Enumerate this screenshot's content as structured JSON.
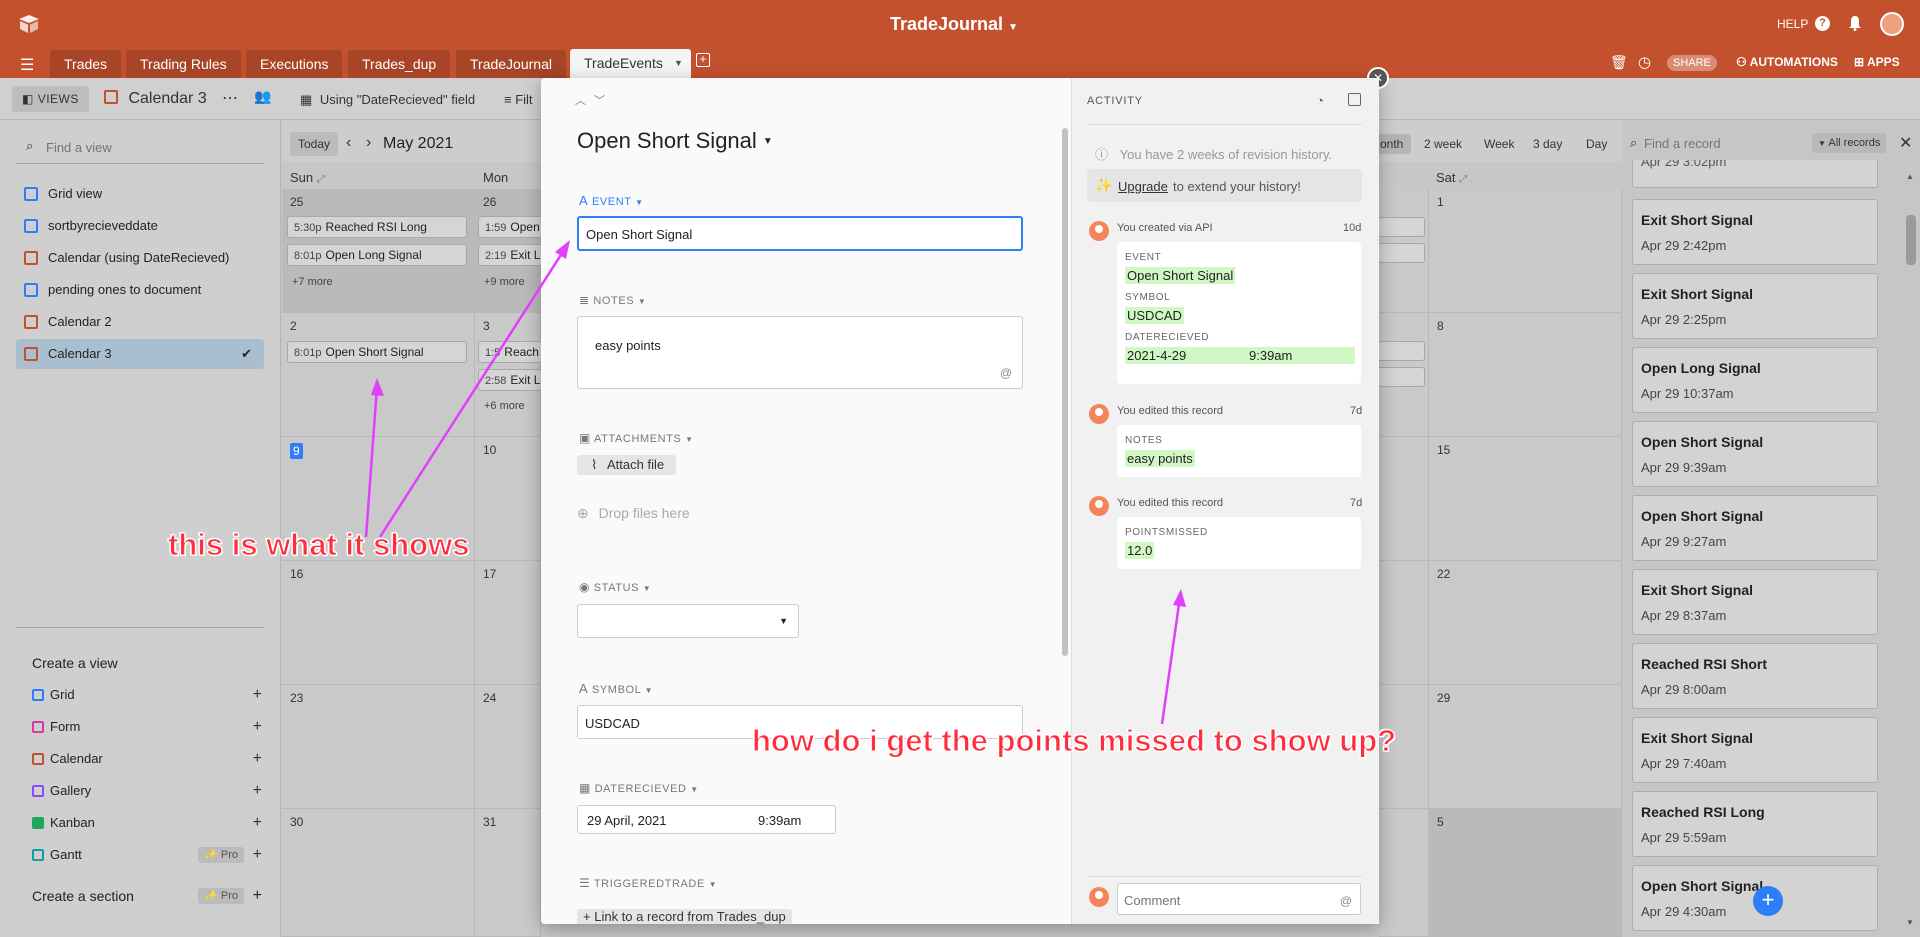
{
  "app": {
    "title": "TradeJournal",
    "help": "HELP"
  },
  "tabs": [
    "Trades",
    "Trading Rules",
    "Executions",
    "Trades_dup",
    "TradeJournal",
    "TradeEvents"
  ],
  "toolbar": {
    "views": "VIEWS",
    "view_name": "Calendar 3",
    "using": "Using \"DateRecieved\" field",
    "filter": "Filt",
    "share": "SHARE",
    "automations": "AUTOMATIONS",
    "apps": "APPS"
  },
  "sidebar": {
    "find_placeholder": "Find a view",
    "views": [
      "Grid view",
      "sortbyrecieveddate",
      "Calendar (using DateRecieved)",
      "pending ones to document",
      "Calendar 2",
      "Calendar 3"
    ],
    "create_view": "Create a view",
    "create_items": [
      "Grid",
      "Form",
      "Calendar",
      "Gallery",
      "Kanban",
      "Gantt"
    ],
    "pro": "Pro",
    "create_section": "Create a section"
  },
  "calendar": {
    "today": "Today",
    "month": "May 2021",
    "modes": [
      "onth",
      "2 week",
      "Week",
      "3 day",
      "Day"
    ],
    "days": [
      "Sun",
      "Mon",
      "Sat"
    ],
    "sun_dates": [
      "25",
      "2",
      "9",
      "16",
      "23",
      "30"
    ],
    "mon_dates": [
      "26",
      "3",
      "10",
      "17",
      "24",
      "31"
    ],
    "sat_dates": [
      "1",
      "8",
      "15",
      "22",
      "29",
      "5"
    ],
    "ev_sun25_1_time": "5:30p",
    "ev_sun25_1": "Reached RSI Long",
    "ev_sun25_2_time": "8:01p",
    "ev_sun25_2": "Open Long Signal",
    "sun25_more": "+7 more",
    "ev_mon26_1_time": "1:59",
    "ev_mon26_1": "Open",
    "ev_mon26_2_time": "2:19",
    "ev_mon26_2": "Exit Lo",
    "mon26_more": "+9 more",
    "ev_sun2_time": "8:01p",
    "ev_sun2": "Open Short Signal",
    "ev_mon3_1_time": "1:5",
    "ev_mon3_1": "Reach",
    "ev_mon3_2_time": "2:58",
    "ev_mon3_2": "Exit Lo",
    "mon3_more": "+6 more"
  },
  "records": {
    "find_placeholder": "Find a record",
    "filter": "All records",
    "partial_top": "Apr 29 3:02pm",
    "items": [
      {
        "title": "Exit Short Signal",
        "date": "Apr 29 2:42pm"
      },
      {
        "title": "Exit Short Signal",
        "date": "Apr 29 2:25pm"
      },
      {
        "title": "Open Long Signal",
        "date": "Apr 29 10:37am"
      },
      {
        "title": "Open Short Signal",
        "date": "Apr 29 9:39am"
      },
      {
        "title": "Open Short Signal",
        "date": "Apr 29 9:27am"
      },
      {
        "title": "Exit Short Signal",
        "date": "Apr 29 8:37am"
      },
      {
        "title": "Reached RSI Short",
        "date": "Apr 29 8:00am"
      },
      {
        "title": "Exit Short Signal",
        "date": "Apr 29 7:40am"
      },
      {
        "title": "Reached RSI Long",
        "date": "Apr 29 5:59am"
      },
      {
        "title": "Open Short Signal",
        "date": "Apr 29 4:30am"
      }
    ]
  },
  "record": {
    "title": "Open Short Signal",
    "event_label": "EVENT",
    "event_value": "Open Short Signal",
    "notes_label": "NOTES",
    "notes_value": "easy points",
    "attachments_label": "ATTACHMENTS",
    "attach_button": "Attach file",
    "drop_text": "Drop files here",
    "status_label": "STATUS",
    "symbol_label": "SYMBOL",
    "symbol_value": "USDCAD",
    "date_label": "DATERECIEVED",
    "date_value": "29 April, 2021",
    "time_value": "9:39am",
    "triggered_label": "TRIGGEREDTRADE",
    "link_button": "Link to a record from Trades_dup"
  },
  "activity": {
    "header": "ACTIVITY",
    "revision_text": "You have 2 weeks of revision history.",
    "upgrade": "Upgrade",
    "upgrade_rest": "to extend your history!",
    "entry1_head": "You created via API",
    "entry1_age": "10d",
    "e1_k1": "EVENT",
    "e1_v1": "Open Short Signal",
    "e1_k2": "SYMBOL",
    "e1_v2": "USDCAD",
    "e1_k3": "DATERECIEVED",
    "e1_v3": "2021-4-29",
    "e1_v3b": "9:39am",
    "entry2_head": "You edited this record",
    "entry2_age": "7d",
    "e2_k1": "NOTES",
    "e2_v1": "easy points",
    "entry3_head": "You edited this record",
    "entry3_age": "7d",
    "e3_k1": "POINTSMISSED",
    "e3_v1": "12.0",
    "comment_placeholder": "Comment"
  },
  "annotations": {
    "left": "this is what it shows",
    "right": "how do i get the points missed to show up?"
  },
  "colors": {
    "brand": "#c4512e",
    "accent": "#2d7ff9",
    "annotation": "#ff2d3d",
    "arrow": "#e040fb",
    "highlight": "#d1f7c4"
  }
}
